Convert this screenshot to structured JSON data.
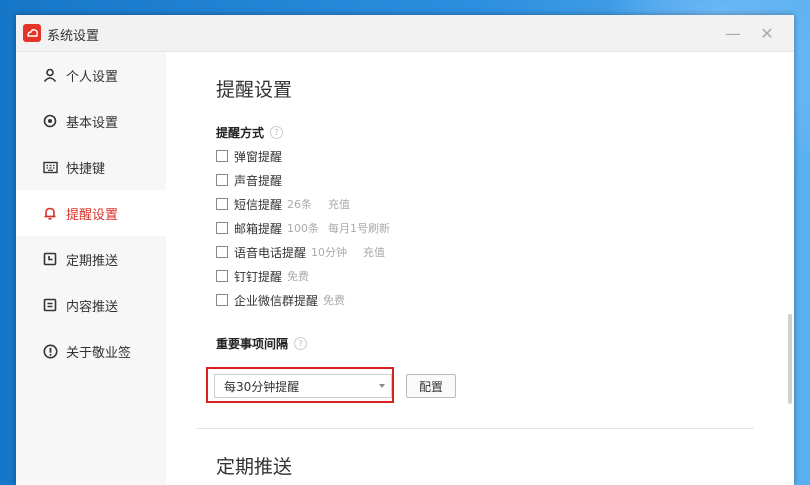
{
  "window": {
    "title": "系统设置"
  },
  "titlebar": {
    "minimize_glyph": "—",
    "close_glyph": "✕"
  },
  "sidebar": {
    "items": [
      {
        "label": "个人设置",
        "icon": "person-icon"
      },
      {
        "label": "基本设置",
        "icon": "gear-icon"
      },
      {
        "label": "快捷键",
        "icon": "keyboard-icon"
      },
      {
        "label": "提醒设置",
        "icon": "bell-icon",
        "active": true
      },
      {
        "label": "定期推送",
        "icon": "calendar-icon"
      },
      {
        "label": "内容推送",
        "icon": "document-icon"
      },
      {
        "label": "关于敬业签",
        "icon": "info-icon"
      }
    ]
  },
  "main": {
    "section_title": "提醒设置",
    "method_title": "提醒方式",
    "help_glyph": "?",
    "methods": [
      {
        "label": "弹窗提醒",
        "checked": false
      },
      {
        "label": "声音提醒",
        "checked": false
      },
      {
        "label": "短信提醒",
        "note": "26条",
        "action": "充值",
        "checked": false
      },
      {
        "label": "邮箱提醒",
        "note": "100条",
        "action": "每月1号刷新",
        "checked": false
      },
      {
        "label": "语音电话提醒",
        "note": "10分钟",
        "action": "充值",
        "checked": false
      },
      {
        "label": "钉钉提醒",
        "note": "免费",
        "checked": false
      },
      {
        "label": "企业微信群提醒",
        "note": "免费",
        "checked": false
      }
    ],
    "interval_title": "重要事项间隔",
    "interval_value": "每30分钟提醒",
    "config_label": "配置",
    "next_section_title": "定期推送"
  },
  "colors": {
    "accent": "#d9302a",
    "highlight_frame": "#d9211f",
    "desktop": "#1e7fd4"
  }
}
